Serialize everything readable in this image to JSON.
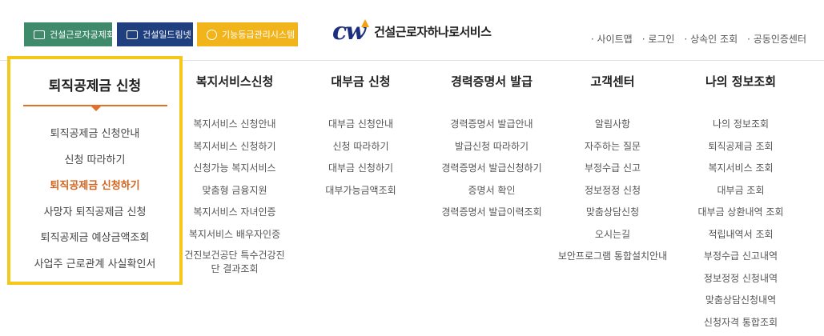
{
  "topbar": {
    "sites": [
      "건설근로자공제회",
      "건설일드림넷",
      "기능등급관리시스템"
    ],
    "colors": {
      "site1": "#3f8a6a",
      "site2": "#1f3f7f",
      "site3": "#f2b41b"
    }
  },
  "logo": {
    "mark": "cw",
    "name": "건설근로자하나로서비스"
  },
  "util_links": [
    "사이트맵",
    "로그인",
    "상속인 조회",
    "공동인증센터"
  ],
  "menu": {
    "retirement": {
      "title": "퇴직공제금 신청",
      "items": [
        "퇴직공제금 신청안내",
        "신청 따라하기",
        "퇴직공제금 신청하기",
        "사망자 퇴직공제금 신청",
        "퇴직공제금 예상금액조회",
        "사업주 근로관계 사실확인서"
      ],
      "active_index": 2
    },
    "welfare": {
      "title": "복지서비스신청",
      "items": [
        "복지서비스 신청안내",
        "복지서비스 신청하기",
        "신청가능 복지서비스",
        "맞춤형 금융지원",
        "복지서비스 자녀인증",
        "복지서비스 배우자인증",
        "건진보건공단 특수건강진단 결과조회"
      ]
    },
    "loan": {
      "title": "대부금 신청",
      "items": [
        "대부금 신청안내",
        "신청 따라하기",
        "대부금 신청하기",
        "대부가능금액조회"
      ]
    },
    "career": {
      "title": "경력증명서 발급",
      "items": [
        "경력증명서 발급안내",
        "발급신청 따라하기",
        "경력증명서 발급신청하기",
        "증명서 확인",
        "경력증명서 발급이력조회"
      ]
    },
    "support": {
      "title": "고객센터",
      "items": [
        "알림사항",
        "자주하는 질문",
        "부정수급 신고",
        "정보정정 신청",
        "맞춤상담신청",
        "오시는길",
        "보안프로그램 통합설치안내"
      ]
    },
    "myinfo": {
      "title": "나의 정보조회",
      "items": [
        "나의 정보조회",
        "퇴직공제금 조회",
        "복지서비스 조회",
        "대부금 조회",
        "대부금 상환내역 조회",
        "적립내역서 조회",
        "부정수급 신고내역",
        "정보정정 신청내역",
        "맞춤상담신청내역",
        "신청자격 통합조회"
      ]
    }
  },
  "accent": {
    "highlight_border": "#f5c71a",
    "active_text": "#d2641e"
  }
}
